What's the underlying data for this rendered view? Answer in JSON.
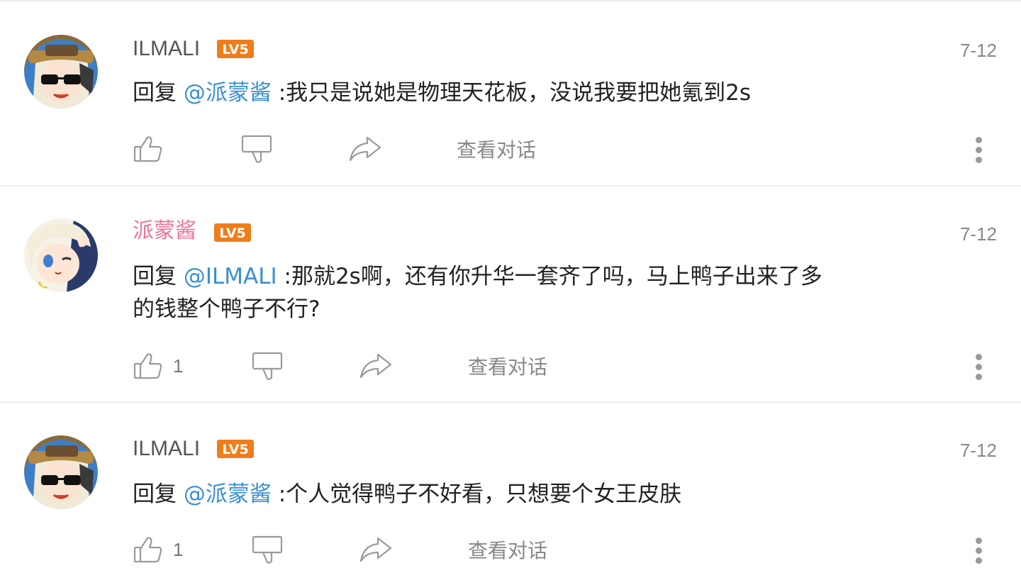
{
  "comments": [
    {
      "username": "ILMALI",
      "level": "LV5",
      "date": "7-12",
      "reply_prefix": "回复 ",
      "mention": "@派蒙酱",
      "text": " :我只是说她是物理天花板，没说我要把她氪到2s",
      "like_count": "",
      "view_dialog": "查看对话"
    },
    {
      "username": "派蒙酱",
      "level": "LV5",
      "date": "7-12",
      "reply_prefix": "回复 ",
      "mention": "@ILMALI",
      "text": " :那就2s啊，还有你升华一套齐了吗，马上鸭子出来了多的钱整个鸭子不行?",
      "like_count": "1",
      "view_dialog": "查看对话"
    },
    {
      "username": "ILMALI",
      "level": "LV5",
      "date": "7-12",
      "reply_prefix": "回复 ",
      "mention": "@派蒙酱",
      "text": " :个人觉得鸭子不好看，只想要个女王皮肤",
      "like_count": "1",
      "view_dialog": "查看对话"
    }
  ],
  "colors": {
    "username_highlight": "#f0739a",
    "mention": "#3a8fd1",
    "level_badge": "#ef7d1a"
  },
  "icons": [
    "thumbs-up-icon",
    "thumbs-down-icon",
    "share-icon",
    "more-vertical-icon"
  ]
}
